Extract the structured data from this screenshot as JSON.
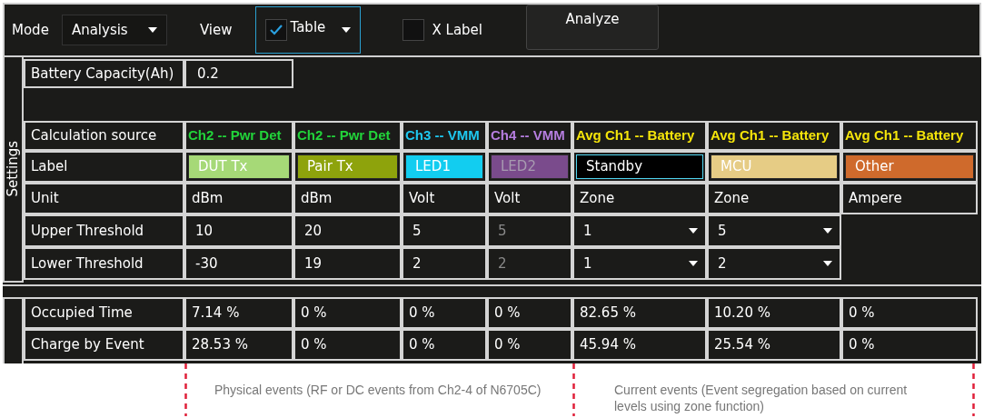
{
  "toolbar": {
    "mode_label": "Mode",
    "mode_value": "Analysis",
    "view_label": "View",
    "view_option": {
      "label": "Table",
      "checked": true,
      "focused": true
    },
    "x_label": {
      "label": "X Label",
      "checked": false
    },
    "analyze_button": "Analyze"
  },
  "side_label": "Settings",
  "battery": {
    "label": "Battery Capacity(Ah)",
    "value": "0.2"
  },
  "row_labels": {
    "source": "Calculation source",
    "label": "Label",
    "unit": "Unit",
    "upper": "Upper Threshold",
    "lower": "Lower Threshold",
    "occupied": "Occupied Time",
    "charge": "Charge by Event"
  },
  "columns": [
    {
      "kind": "text",
      "source": {
        "text": "Ch2 -- Pwr Det",
        "color": "#22d33a"
      },
      "label": {
        "text": "DUT Tx",
        "color": "#a6d977",
        "selected": false
      },
      "disabled": false,
      "unit": "dBm",
      "upper": "10",
      "lower": "-30",
      "occupied": "7.14 %",
      "charge": "28.53 %"
    },
    {
      "kind": "text",
      "source": {
        "text": "Ch2 -- Pwr Det",
        "color": "#22d33a"
      },
      "label": {
        "text": "Pair Tx",
        "color": "#8ea30c",
        "selected": false
      },
      "disabled": false,
      "unit": "dBm",
      "upper": "20",
      "lower": "19",
      "occupied": "0 %",
      "charge": "0 %"
    },
    {
      "kind": "text",
      "source": {
        "text": "Ch3 -- VMM",
        "color": "#1ec8f0"
      },
      "label": {
        "text": "LED1",
        "color": "#12cdf0",
        "selected": false
      },
      "disabled": false,
      "unit": "Volt",
      "upper": "5",
      "lower": "2",
      "occupied": "0 %",
      "charge": "0 %"
    },
    {
      "kind": "text",
      "source": {
        "text": "Ch4 -- VMM",
        "color": "#b67ee0"
      },
      "label": {
        "text": "LED2",
        "color": "#7a4b8c",
        "selected": false
      },
      "disabled": true,
      "unit": "Volt",
      "upper": "5",
      "lower": "2",
      "occupied": "0 %",
      "charge": "0 %"
    },
    {
      "kind": "dropdown",
      "source": {
        "text": "Avg Ch1 -- Battery",
        "color": "#f5e50a"
      },
      "label": {
        "text": "Standby",
        "color": "#000000",
        "selected": true
      },
      "disabled": false,
      "unit": "Zone",
      "upper": "1",
      "lower": "1",
      "occupied": "82.65 %",
      "charge": "45.94 %"
    },
    {
      "kind": "dropdown",
      "source": {
        "text": "Avg Ch1 -- Battery",
        "color": "#f5e50a"
      },
      "label": {
        "text": "MCU",
        "color": "#e6cc85",
        "selected": false
      },
      "disabled": false,
      "unit": "Zone",
      "upper": "5",
      "lower": "2",
      "occupied": "10.20 %",
      "charge": "25.54 %"
    },
    {
      "kind": "none",
      "source": {
        "text": "Avg Ch1 -- Battery",
        "color": "#f5e50a"
      },
      "label": {
        "text": "Other",
        "color": "#cf6a2c",
        "selected": false
      },
      "disabled": false,
      "unit": "Ampere",
      "occupied": "0 %",
      "charge": "0 %"
    }
  ],
  "annotations": [
    "Physical events (RF or DC events from Ch2-4 of N6705C)",
    "Current events (Event segregation based on current levels using zone function)"
  ]
}
